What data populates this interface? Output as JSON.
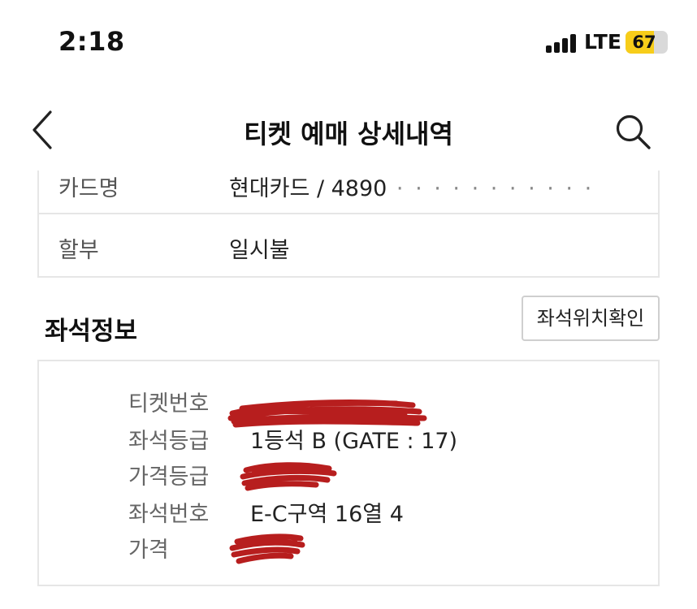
{
  "status_bar": {
    "time": "2:18",
    "network": "LTE",
    "battery": "67",
    "battery_color": "#f7cd1a"
  },
  "nav": {
    "title": "티켓 예매 상세내역",
    "back_icon": "chevron-left-icon",
    "search_icon": "search-icon"
  },
  "payment": {
    "rows": [
      {
        "label": "카드명",
        "value": "현대카드 / 4890"
      },
      {
        "label": "할부",
        "value": "일시불"
      }
    ]
  },
  "seat_info": {
    "title": "좌석정보",
    "check_button": "좌석위치확인",
    "rows": [
      {
        "label": "티켓번호",
        "value": "",
        "redacted": true
      },
      {
        "label": "좌석등급",
        "value": "1등석 B (GATE : 17)"
      },
      {
        "label": "가격등급",
        "value": "",
        "redacted": true
      },
      {
        "label": "좌석번호",
        "value": "E-C구역 16열 4"
      },
      {
        "label": "가격",
        "value": "",
        "redacted": true
      }
    ],
    "redaction_color": "#b31212"
  }
}
